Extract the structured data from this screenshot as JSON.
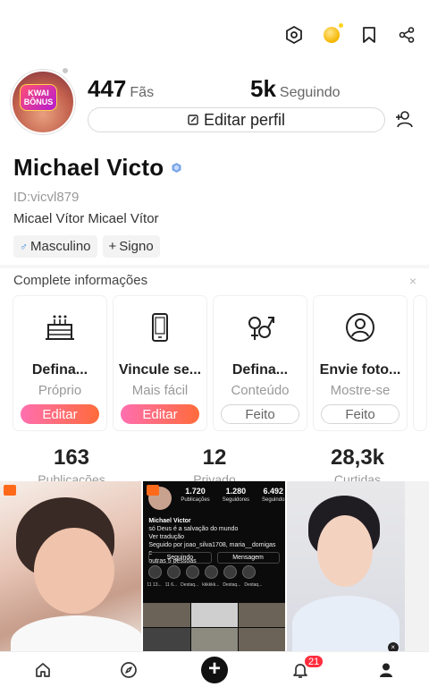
{
  "top_actions": [
    "qr-scan-icon",
    "coin-icon",
    "bookmark-icon",
    "share-icon"
  ],
  "profile": {
    "avatar_badge_line1": "KWAI",
    "avatar_badge_line2": "BÔNUS",
    "fans_count": "447",
    "fans_label": "Fãs",
    "following_count": "5k",
    "following_label": "Seguindo",
    "edit_label": "Editar perfil",
    "name": "Michael Victo",
    "user_id": "ID:vicvl879",
    "bio": "Micael Vítor Micael Vítor",
    "tags": [
      {
        "symbol": "♂",
        "label": "Masculino"
      },
      {
        "symbol": "+",
        "label": "Signo"
      }
    ]
  },
  "complete_info": {
    "title": "Complete informações",
    "close": "×",
    "cards": [
      {
        "icon": "cake-icon",
        "title": "Defina...",
        "subtitle": "Próprio",
        "button": "Editar",
        "style": "grad"
      },
      {
        "icon": "phone-icon",
        "title": "Vincule se...",
        "subtitle": "Mais fácil",
        "button": "Editar",
        "style": "grad"
      },
      {
        "icon": "gender-icon",
        "title": "Defina...",
        "subtitle": "Conteúdo",
        "button": "Feito",
        "style": "outline"
      },
      {
        "icon": "user-circle-icon",
        "title": "Envie foto...",
        "subtitle": "Mostre-se",
        "button": "Feito",
        "style": "outline"
      }
    ]
  },
  "counts": [
    {
      "value": "163",
      "label": "Publicações"
    },
    {
      "value": "12",
      "label": "Privado"
    },
    {
      "value": "28,3k",
      "label": "Curtidas"
    }
  ],
  "ig_post": {
    "stats": [
      {
        "value": "1.720",
        "label": "Publicações"
      },
      {
        "value": "1.280",
        "label": "Seguidores"
      },
      {
        "value": "6.492",
        "label": "Seguindo"
      }
    ],
    "name": "Michael Victor",
    "line1": "só Deus é a salvação do mundo",
    "line2": "Ver tradução",
    "line3": "Seguido por joao_silva1708, maria__domigas e",
    "line4": "outras 5 pessoas",
    "btn1": "Seguindo",
    "btn2": "Mensagem",
    "highlights": [
      "11 13...",
      "11 6...",
      "Destaq...",
      "kkkkkk...",
      "Destaq...",
      "Destaq..."
    ]
  },
  "bottom_nav": {
    "notification_count": "21"
  }
}
